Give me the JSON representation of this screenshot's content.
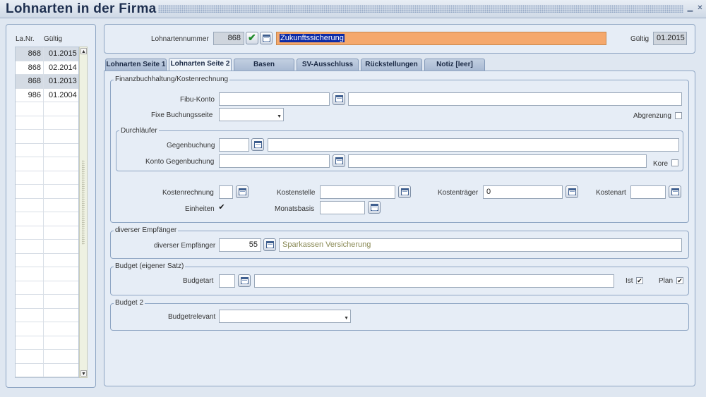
{
  "window": {
    "title": "Lohnarten in der Firma",
    "minimize_glyph": "▁",
    "close_glyph": "✕"
  },
  "list": {
    "col_nr": "La.Nr.",
    "col_gueltig": "Gültig",
    "rows": [
      {
        "nr": "868",
        "gueltig": "01.2015"
      },
      {
        "nr": "868",
        "gueltig": "02.2014"
      },
      {
        "nr": "868",
        "gueltig": "01.2013"
      },
      {
        "nr": "986",
        "gueltig": "01.2004"
      }
    ],
    "scroll_up": "▲",
    "scroll_down": "▼"
  },
  "header": {
    "lohnartennummer_label": "Lohnartennummer",
    "lohnartennummer_value": "868",
    "bezeichnung": "Zukunftssicherung",
    "gueltig_label": "Gültig",
    "gueltig_value": "01.2015"
  },
  "tabs": [
    {
      "label": "Lohnarten Seite 1",
      "active": false
    },
    {
      "label": "Lohnarten Seite 2",
      "active": true
    },
    {
      "label": "Basen",
      "active": false
    },
    {
      "label": "SV-Ausschluss",
      "active": false
    },
    {
      "label": "Rückstellungen",
      "active": false
    },
    {
      "label": "Notiz [leer]",
      "active": false
    }
  ],
  "fibu": {
    "title": "Finanzbuchhaltung/Kostenrechnung",
    "fibu_konto_label": "Fibu-Konto",
    "fixe_buchungsseite_label": "Fixe Buchungsseite",
    "abgrenzung_label": "Abgrenzung",
    "durchlaeufer_title": "Durchläufer",
    "gegenbuchung_label": "Gegenbuchung",
    "konto_gegenbuchung_label": "Konto Gegenbuchung",
    "kore_label": "Kore",
    "kostenrechnung_label": "Kostenrechnung",
    "kostenstelle_label": "Kostenstelle",
    "kostentraeger_label": "Kostenträger",
    "kostentraeger_value": "0",
    "kostenart_label": "Kostenart",
    "einheiten_label": "Einheiten",
    "monatsbasis_label": "Monatsbasis",
    "check_glyph": "✔"
  },
  "empfaenger": {
    "title": "diverser Empfänger",
    "label": "diverser Empfänger",
    "number": "55",
    "name": "Sparkassen Versicherung"
  },
  "budget": {
    "title": "Budget (eigener Satz)",
    "budgetart_label": "Budgetart",
    "ist_label": "Ist",
    "plan_label": "Plan"
  },
  "budget2": {
    "title": "Budget 2",
    "budgetrelevant_label": "Budgetrelevant"
  },
  "dropdown_glyph": "▼",
  "checkbox_glyph": "✔"
}
